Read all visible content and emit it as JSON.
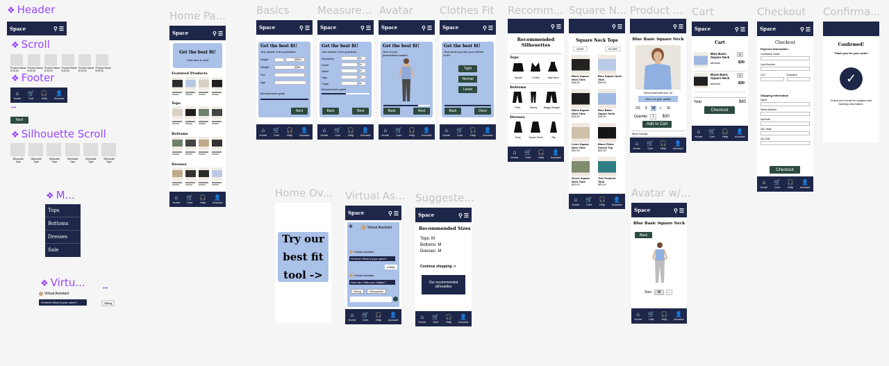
{
  "component_labels": {
    "header": "Header",
    "scroll": "Scroll",
    "footer": "Footer",
    "silhouette_scroll": "Silhouette Scroll",
    "menu": "M...",
    "virtual": "Virtu..."
  },
  "frame_labels": {
    "home": "Home Pa...",
    "basics": "Basics",
    "measure": "Measure...",
    "avatar": "Avatar",
    "clothes_fit": "Clothes Fit",
    "recommend": "Recomm...",
    "square_neck": "Square N...",
    "product": "Product ...",
    "cart": "Cart",
    "checkout": "Checkout",
    "confirm": "Confirma...",
    "home_ov": "Home Ov...",
    "virtual_asst": "Virtual As...",
    "suggested": "Suggeste...",
    "avatar_w": "Avatar w/..."
  },
  "brand": "Space",
  "footer_items": [
    "Home",
    "Cart",
    "Help",
    "Account"
  ],
  "scroll_items": [
    "Product Name",
    "Product Name",
    "Product Name",
    "Product Name",
    "Product Name",
    "Product Name"
  ],
  "scroll_prices": [
    "$ 00.00",
    "$ 00.00",
    "$ 00.00",
    "$ 00.00",
    "$ 00.00",
    "$ 00.00"
  ],
  "dots": "•••",
  "next": "Next",
  "back": "Back",
  "done": "Done",
  "silhouette_items": [
    "Silhouette Type",
    "Silhouette Type",
    "Silhouette Type",
    "Silhouette Type",
    "Silhouette Type",
    "Silhouette Type"
  ],
  "menu_items": [
    "Tops",
    "Bottoms",
    "Dresses",
    "Sale"
  ],
  "assistant": {
    "name": "Virtual Assistant",
    "greeting": "Hi there! What is your name?",
    "reply": "Kaitlyn",
    "question": "How can I help you, Kaitlyn?",
    "chips": [
      "Sizing",
      "Silhouettes"
    ],
    "chip_small": "Sizing"
  },
  "home": {
    "hero_title": "Get the best fit!",
    "hero_sub": "Click here to start",
    "sections": [
      "Featured Products",
      "Tops",
      "Bottoms",
      "Dresses"
    ]
  },
  "basics": {
    "title": "Get the best fit!",
    "sub": "Just answer a few questions:",
    "fields": [
      "Height",
      "Weight",
      "Sex",
      "Age"
    ],
    "unit_h": "ft/in",
    "unit_w": "lbs",
    "guide": "Measurement guide"
  },
  "measure": {
    "title": "Get the best fit!",
    "sub": "Just answer a few questions:",
    "fields": [
      "Shoulders",
      "Chest",
      "Waist",
      "Hips",
      "Thigh"
    ],
    "unit": "in",
    "guide": "Measurement guide"
  },
  "avatar": {
    "title": "Get the best fit!",
    "sub": "Here is your personalized avatar!"
  },
  "fit": {
    "title": "Get the best fit!",
    "sub": "How would you like your clothes to fit?",
    "options": [
      "Tight",
      "Normal",
      "Loose"
    ]
  },
  "recommend": {
    "title": "Recommended Silhouettes",
    "groups": [
      {
        "name": "Tops",
        "items": [
          "Square",
          "V-Neck",
          "High Neck"
        ]
      },
      {
        "name": "Bottoms",
        "items": [
          "Flare",
          "Skinny",
          "Baggy Straight"
        ]
      },
      {
        "name": "Dresses",
        "items": [
          "Wrap",
          "Square Neck",
          "Slip"
        ]
      }
    ]
  },
  "square_neck": {
    "title": "Square Neck Tops",
    "sort": "SORT",
    "filter": "FILTER",
    "products": [
      {
        "name": "Black Square Neck Tank",
        "price": "$18.00"
      },
      {
        "name": "Blue Square Neck Tank",
        "price": "$18.00"
      },
      {
        "name": "Black Square Neck Tank",
        "price": "$18.00"
      },
      {
        "name": "Blue Basic Square Neck",
        "price": "$18.00"
      },
      {
        "name": "Linen Square Neck Tank",
        "price": "$20.00"
      },
      {
        "name": "Black Fitted Smock Top",
        "price": "$20.00"
      },
      {
        "name": "Green Square Neck Tank",
        "price": "$20.00"
      },
      {
        "name": "Teal Textured Tank",
        "price": "$20.00"
      }
    ]
  },
  "product": {
    "title": "Blue Basic Square Neck",
    "rec_size": "Recommended size: M",
    "see_btn": "See it on your avatar",
    "sizes": [
      "XS",
      "S",
      "M",
      "L",
      "XL"
    ],
    "quantity_label": "Quantity:",
    "quantity": "1",
    "price": "$30",
    "add": "Add to Cart",
    "more": "More Details"
  },
  "cart": {
    "title": "Cart",
    "items": [
      {
        "name": "Blue Basic Square Neck",
        "size": "Medium",
        "qty": "1",
        "price": "$30"
      },
      {
        "name": "Black Basic Square Neck",
        "size": "Medium",
        "qty": "1",
        "price": "$30"
      }
    ],
    "total_label": "Total:",
    "total": "$60",
    "checkout": "Checkout"
  },
  "checkout": {
    "title": "Checkout",
    "payment": "Payment Information",
    "fields": [
      "Cardholder Name",
      "Card Number",
      "CVV",
      "Expiration"
    ],
    "shipping": "Shipping Information",
    "ship_fields": [
      "Name",
      "Street Address",
      "Apt/Suite",
      "City, State",
      "Zip Code"
    ],
    "button": "Checkout"
  },
  "confirm": {
    "title": "Confirmed!",
    "thanks": "Thank you for your order!",
    "note": "Check your email for updates and tracking information."
  },
  "home_ov": {
    "text": "Try our best fit tool ->"
  },
  "suggested": {
    "title": "Recommended Sizes",
    "lines": [
      "Tops: M",
      "Bottoms: M",
      "Dresses: M"
    ],
    "continue": "Continue shopping ->",
    "button": "Our recommended silhouettes"
  },
  "avatar_w": {
    "title": "Blue Basic Square Neck",
    "back": "Back",
    "size_label": "Size:",
    "size": "M"
  },
  "colors": {
    "navy": "#1e2749",
    "green": "#2c4a3e",
    "blue": "#aac1e8",
    "purple": "#9747ff"
  }
}
